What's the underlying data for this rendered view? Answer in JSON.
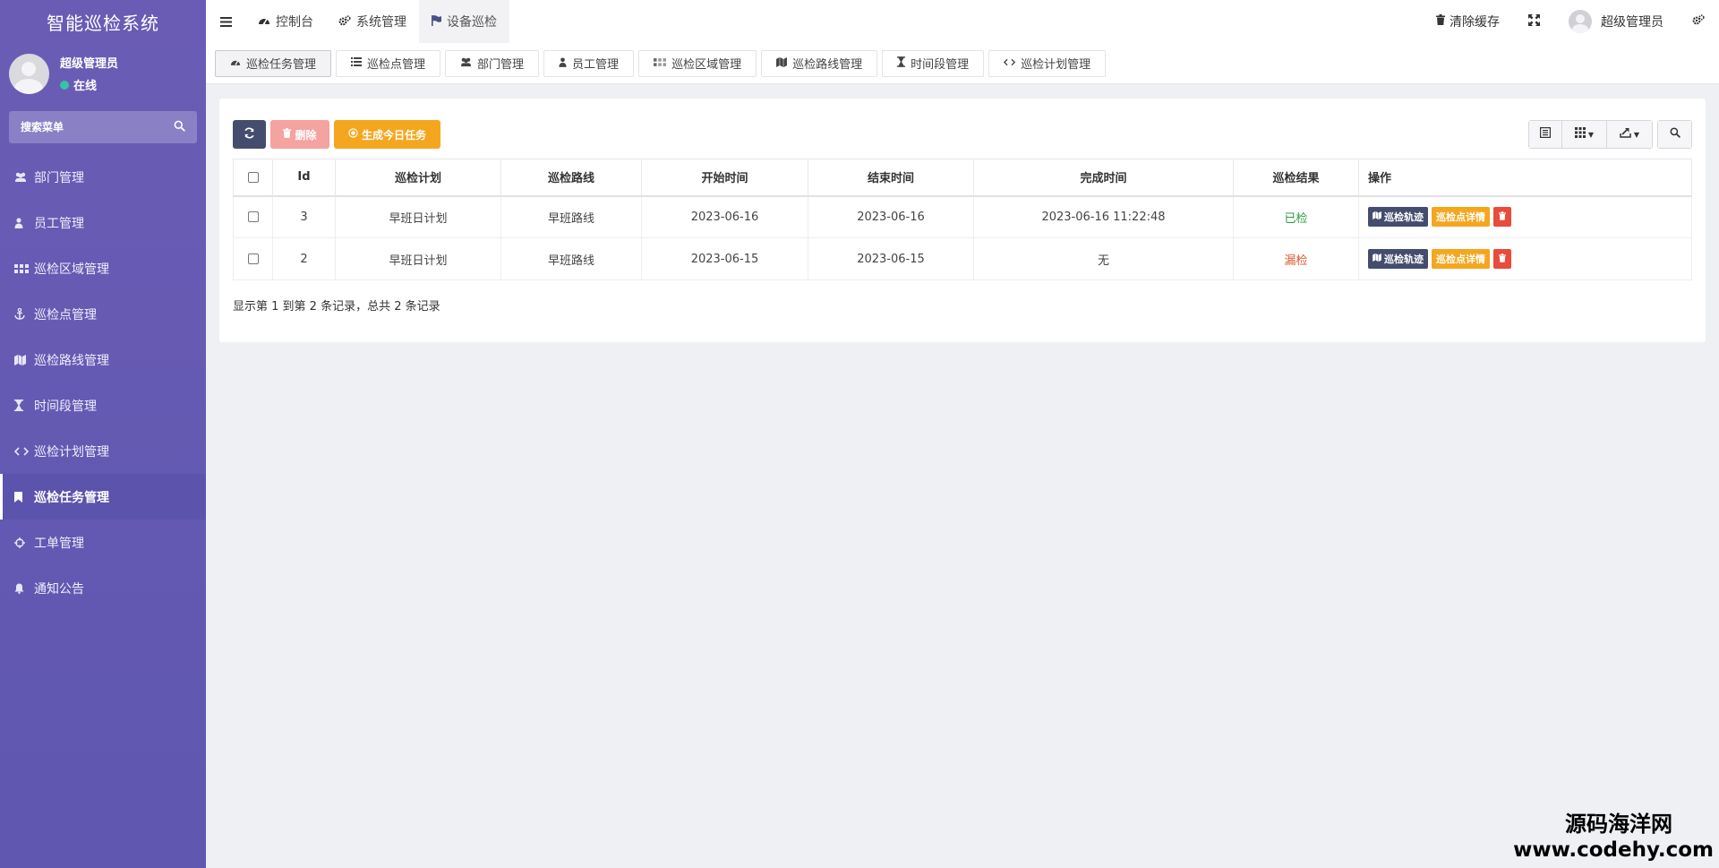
{
  "sidebar": {
    "brand": "智能巡检系统",
    "user_name": "超级管理员",
    "user_status": "在线",
    "search_placeholder": "搜索菜单",
    "items": [
      {
        "label": "部门管理",
        "icon": "users-icon"
      },
      {
        "label": "员工管理",
        "icon": "user-icon"
      },
      {
        "label": "巡检区域管理",
        "icon": "grid-icon"
      },
      {
        "label": "巡检点管理",
        "icon": "anchor-icon"
      },
      {
        "label": "巡检路线管理",
        "icon": "map-icon"
      },
      {
        "label": "时间段管理",
        "icon": "hourglass-icon"
      },
      {
        "label": "巡检计划管理",
        "icon": "code-icon"
      },
      {
        "label": "巡检任务管理",
        "icon": "bookmark-icon",
        "active": true
      },
      {
        "label": "工单管理",
        "icon": "crosshair-icon"
      },
      {
        "label": "通知公告",
        "icon": "bell-icon"
      }
    ]
  },
  "header": {
    "nav": [
      {
        "label": "控制台",
        "icon": "dashboard-icon"
      },
      {
        "label": "系统管理",
        "icon": "cogs-icon"
      },
      {
        "label": "设备巡检",
        "icon": "flag-icon",
        "active": true
      }
    ],
    "clear_cache": "清除缓存",
    "user_name": "超级管理员"
  },
  "tabs": [
    {
      "label": "巡检任务管理",
      "icon": "dashboard-icon",
      "active": true
    },
    {
      "label": "巡检点管理",
      "icon": "list-icon"
    },
    {
      "label": "部门管理",
      "icon": "users-icon"
    },
    {
      "label": "员工管理",
      "icon": "user-icon"
    },
    {
      "label": "巡检区域管理",
      "icon": "grid-icon"
    },
    {
      "label": "巡检路线管理",
      "icon": "map-icon"
    },
    {
      "label": "时间段管理",
      "icon": "hourglass-icon"
    },
    {
      "label": "巡检计划管理",
      "icon": "code-icon"
    }
  ],
  "toolbar": {
    "delete_label": "删除",
    "generate_label": "生成今日任务"
  },
  "table": {
    "columns": [
      "Id",
      "巡检计划",
      "巡检路线",
      "开始时间",
      "结束时间",
      "完成时间",
      "巡检结果",
      "操作"
    ],
    "rows": [
      {
        "id": "3",
        "plan": "早班日计划",
        "route": "早班路线",
        "start": "2023-06-16",
        "end": "2023-06-16",
        "finish": "2023-06-16 11:22:48",
        "result": "已检",
        "result_status": "ok"
      },
      {
        "id": "2",
        "plan": "早班日计划",
        "route": "早班路线",
        "start": "2023-06-15",
        "end": "2023-06-15",
        "finish": "无",
        "result": "漏检",
        "result_status": "miss"
      }
    ],
    "actions": {
      "track": "巡检轨迹",
      "detail": "巡检点详情"
    }
  },
  "pagination_info": "显示第 1 到第 2 条记录，总共 2 条记录",
  "watermark": {
    "cn": "源码海洋网",
    "url": "www.codehy.com"
  },
  "colors": {
    "sidebar": "#6a5cb5",
    "primary_dark": "#444d6e",
    "warning": "#f4a71e",
    "danger": "#e74c3c",
    "success_text": "#2c9b3e",
    "miss_text": "#d9572c"
  }
}
